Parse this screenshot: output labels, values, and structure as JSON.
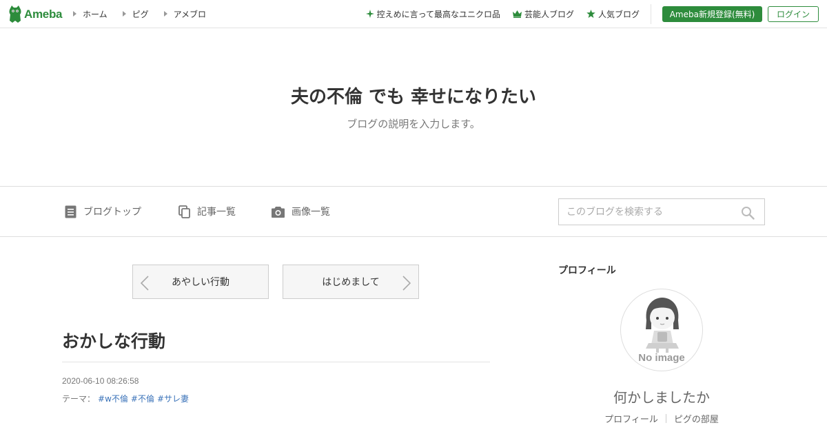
{
  "header": {
    "logo_text": "Ameba",
    "nav_left": [
      "ホーム",
      "ピグ",
      "アメブロ"
    ],
    "nav_right": [
      {
        "label": "控えめに言って最高なユニクロ品",
        "icon": "sparkle-icon"
      },
      {
        "label": "芸能人ブログ",
        "icon": "crown-icon"
      },
      {
        "label": "人気ブログ",
        "icon": "star-icon"
      }
    ],
    "register_label": "Ameba新規登録(無料)",
    "login_label": "ログイン",
    "accent_color": "#2d8c3c"
  },
  "blog": {
    "title": "夫の不倫 でも 幸せになりたい",
    "description": "ブログの説明を入力します。"
  },
  "blog_nav": {
    "items": [
      "ブログトップ",
      "記事一覧",
      "画像一覧"
    ],
    "search_placeholder": "このブログを検索する"
  },
  "pager": {
    "prev_label": "あやしい行動",
    "next_label": "はじめまして"
  },
  "article": {
    "title": "おかしな行動",
    "date": "2020-06-10 08:26:58",
    "theme_label": "テーマ：",
    "tags": [
      "#w不倫",
      "#不倫",
      "#サレ妻"
    ]
  },
  "sidebar": {
    "heading": "プロフィール",
    "avatar_text": "No image",
    "name": "何かしましたか",
    "links": [
      "プロフィール",
      "ピグの部屋"
    ]
  }
}
